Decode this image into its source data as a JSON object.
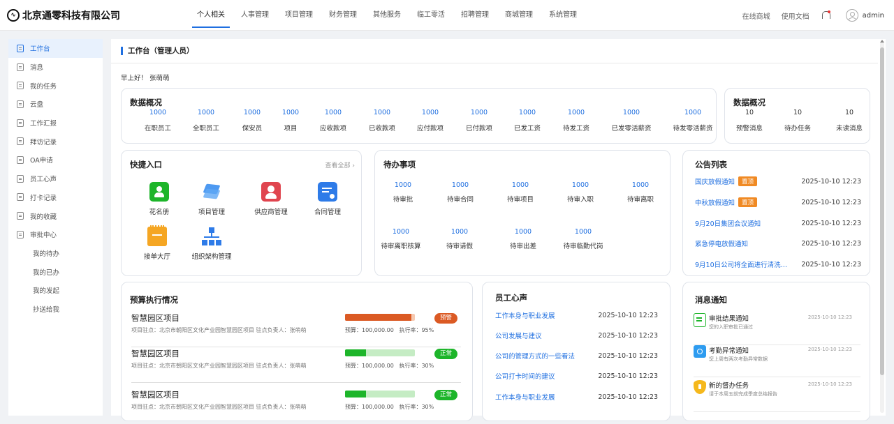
{
  "brand": {
    "name": "北京通零科技有限公司",
    "logo_icon": "pulse-logo-icon"
  },
  "nav": {
    "items": [
      "个人相关",
      "人事管理",
      "项目管理",
      "财务管理",
      "其他服务",
      "临工零活",
      "招聘管理",
      "商城管理",
      "系统管理"
    ],
    "active": 0
  },
  "top_right": {
    "links": [
      "在线商城",
      "使用文档"
    ],
    "user": "admin"
  },
  "sidebar": {
    "items": [
      "工作台",
      "消息",
      "我的任务",
      "云盘",
      "工作汇报",
      "拜访记录",
      "OA申请",
      "员工心声",
      "打卡记录",
      "我的收藏",
      "审批中心"
    ],
    "sub_items": [
      "我的待办",
      "我的已办",
      "我的发起",
      "抄送给我"
    ],
    "active": 0
  },
  "page": {
    "title": "工作台（管理人员）",
    "greeting": "早上好！ 张萌萌"
  },
  "overview": {
    "title": "数据概况",
    "stats": [
      {
        "value": "1000",
        "label": "在职员工"
      },
      {
        "value": "1000",
        "label": "全职员工"
      },
      {
        "value": "1000",
        "label": "保安员"
      },
      {
        "value": "1000",
        "label": "项目"
      },
      {
        "value": "1000",
        "label": "应收款项"
      },
      {
        "value": "1000",
        "label": "已收款项"
      },
      {
        "value": "1000",
        "label": "应付款项"
      },
      {
        "value": "1000",
        "label": "已付款项"
      },
      {
        "value": "1000",
        "label": "已发工资"
      },
      {
        "value": "1000",
        "label": "待发工资"
      },
      {
        "value": "1000",
        "label": "已发零活薪资"
      },
      {
        "value": "1000",
        "label": "待发零活薪资"
      }
    ]
  },
  "overview2": {
    "title": "数据概况",
    "stats": [
      {
        "value": "10",
        "label": "预警消息"
      },
      {
        "value": "10",
        "label": "待办任务"
      },
      {
        "value": "10",
        "label": "未读消息"
      }
    ]
  },
  "quick": {
    "title": "快捷入口",
    "more": "查看全部",
    "items": [
      {
        "label": "花名册",
        "icon": "roster-icon",
        "color": "#1db52a"
      },
      {
        "label": "项目管理",
        "icon": "layers-icon",
        "color": "#3a8ef0"
      },
      {
        "label": "供应商管理",
        "icon": "supplier-icon",
        "color": "#e0454f"
      },
      {
        "label": "合同管理",
        "icon": "contract-icon",
        "color": "#2e7be8"
      },
      {
        "label": "接单大厅",
        "icon": "order-hall-icon",
        "color": "#f5a623"
      },
      {
        "label": "组织架构管理",
        "icon": "org-chart-icon",
        "color": "#2e7be8"
      }
    ]
  },
  "todo": {
    "title": "待办事项",
    "items": [
      {
        "value": "1000",
        "label": "待审批"
      },
      {
        "value": "1000",
        "label": "待审合同"
      },
      {
        "value": "1000",
        "label": "待审项目"
      },
      {
        "value": "1000",
        "label": "待审入职"
      },
      {
        "value": "1000",
        "label": "待审离职"
      },
      {
        "value": "1000",
        "label": "待审离职核算"
      },
      {
        "value": "1000",
        "label": "待审请假"
      },
      {
        "value": "1000",
        "label": "待审出差"
      },
      {
        "value": "1000",
        "label": "待审临勤代岗"
      }
    ]
  },
  "announcements": {
    "title": "公告列表",
    "items": [
      {
        "title": "国庆放假通知",
        "tag": "置顶",
        "date": "2025-10-10 12:23"
      },
      {
        "title": "中秋放假通知",
        "tag": "置顶",
        "date": "2025-10-10 12:23"
      },
      {
        "title": "9月20日集团会议通知",
        "tag": "",
        "date": "2025-10-10 12:23"
      },
      {
        "title": "紧急停电放假通知",
        "tag": "",
        "date": "2025-10-10 12:23"
      },
      {
        "title": "9月10日公司将全面进行清洗和...",
        "tag": "",
        "date": "2025-10-10 12:23"
      }
    ]
  },
  "budget": {
    "title": "预算执行情况",
    "items": [
      {
        "name": "智慧园区项目",
        "info": "项目驻点：北京市朝阳区文化产业园智慧园区项目     驻点负责人：张萌萌",
        "budget": "预算：100,000.00",
        "rate_text": "执行率：95%",
        "rate": 0.95,
        "status": "预警",
        "status_type": "warn",
        "color": "#db5a24"
      },
      {
        "name": "智慧园区项目",
        "info": "项目驻点：北京市朝阳区文化产业园智慧园区项目     驻点负责人：张萌萌",
        "budget": "预算：100,000.00",
        "rate_text": "执行率：30%",
        "rate": 0.3,
        "status": "正常",
        "status_type": "ok",
        "color": "#1db52a"
      },
      {
        "name": "智慧园区项目",
        "info": "项目驻点：北京市朝阳区文化产业园智慧园区项目     驻点负责人：张萌萌",
        "budget": "预算：100,000.00",
        "rate_text": "执行率：30%",
        "rate": 0.3,
        "status": "正常",
        "status_type": "ok",
        "color": "#1db52a"
      }
    ]
  },
  "voices": {
    "title": "员工心声",
    "items": [
      {
        "title": "工作本身与职业发展",
        "date": "2025-10-10 12:23"
      },
      {
        "title": "公司发展与建议",
        "date": "2025-10-10 12:23"
      },
      {
        "title": "公司的管理方式的一些看法",
        "date": "2025-10-10 12:23"
      },
      {
        "title": "公司打卡时间的建议",
        "date": "2025-10-10 12:23"
      },
      {
        "title": "工作本身与职业发展",
        "date": "2025-10-10 12:23"
      }
    ]
  },
  "messages": {
    "title": "消息通知",
    "items": [
      {
        "title": "审批结果通知",
        "sub": "您的入职审批已通过",
        "date": "2025-10-10 12:23",
        "icon": "approval-icon",
        "color": "#1db52a"
      },
      {
        "title": "考勤异常通知",
        "sub": "您上周有两次考勤异常数据",
        "date": "2025-10-10 12:23",
        "icon": "attendance-icon",
        "color": "#2e9cf0"
      },
      {
        "title": "新的督办任务",
        "sub": "请于本周五前完成季度总结报告",
        "date": "2025-10-10 12:23",
        "icon": "supervise-icon",
        "color": "#f5b81c"
      }
    ]
  },
  "colors": {
    "accent": "#1f6fe0",
    "warn": "#db5a24",
    "ok": "#1db52a",
    "tag": "#f08a24"
  }
}
